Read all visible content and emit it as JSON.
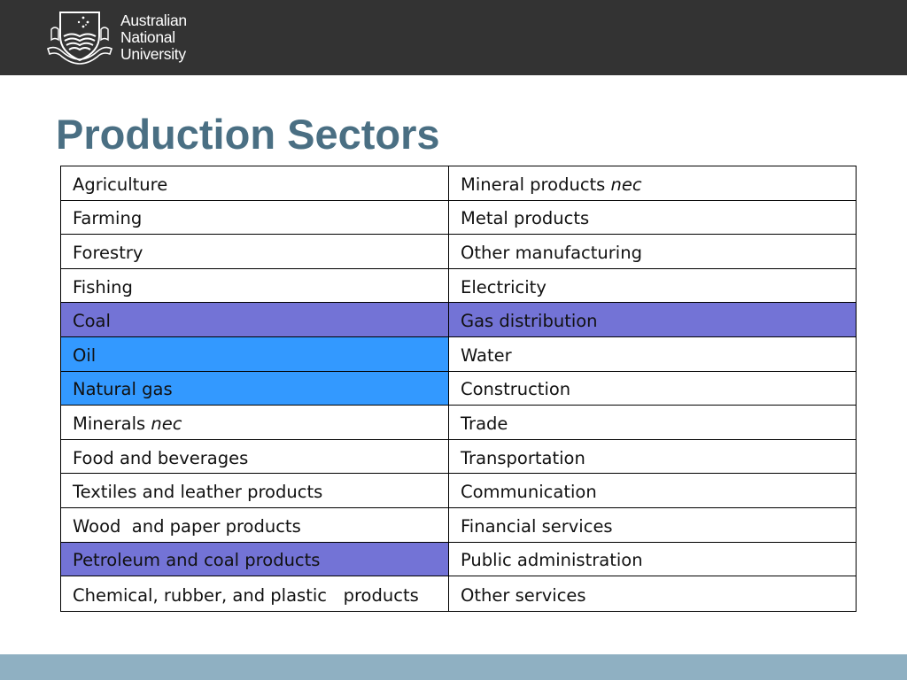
{
  "header": {
    "logo_lines": [
      "Australian",
      "National",
      "University"
    ],
    "crest_icon": "anu-crest-icon",
    "background": "#333333"
  },
  "slide": {
    "title": "Production Sectors",
    "title_color": "#4a6f83"
  },
  "table": {
    "highlight_colors": {
      "purple": "#7373d6",
      "blue": "#3399ff"
    },
    "rows": [
      {
        "left": {
          "text": "Agriculture",
          "suffix": "",
          "highlight": ""
        },
        "right": {
          "text": "Mineral products ",
          "suffix": "nec",
          "highlight": ""
        }
      },
      {
        "left": {
          "text": "Farming",
          "suffix": "",
          "highlight": ""
        },
        "right": {
          "text": "Metal products",
          "suffix": "",
          "highlight": ""
        }
      },
      {
        "left": {
          "text": "Forestry",
          "suffix": "",
          "highlight": ""
        },
        "right": {
          "text": "Other manufacturing",
          "suffix": "",
          "highlight": ""
        }
      },
      {
        "left": {
          "text": "Fishing",
          "suffix": "",
          "highlight": ""
        },
        "right": {
          "text": "Electricity",
          "suffix": "",
          "highlight": ""
        }
      },
      {
        "left": {
          "text": "Coal",
          "suffix": "",
          "highlight": "purple"
        },
        "right": {
          "text": "Gas distribution",
          "suffix": "",
          "highlight": "purple"
        }
      },
      {
        "left": {
          "text": "Oil",
          "suffix": "",
          "highlight": "blue"
        },
        "right": {
          "text": "Water",
          "suffix": "",
          "highlight": ""
        }
      },
      {
        "left": {
          "text": "Natural gas",
          "suffix": "",
          "highlight": "blue"
        },
        "right": {
          "text": "Construction",
          "suffix": "",
          "highlight": ""
        }
      },
      {
        "left": {
          "text": "Minerals ",
          "suffix": "nec",
          "highlight": ""
        },
        "right": {
          "text": "Trade",
          "suffix": "",
          "highlight": ""
        }
      },
      {
        "left": {
          "text": "Food and beverages",
          "suffix": "",
          "highlight": ""
        },
        "right": {
          "text": "Transportation",
          "suffix": "",
          "highlight": ""
        }
      },
      {
        "left": {
          "text": "Textiles and leather products",
          "suffix": "",
          "highlight": ""
        },
        "right": {
          "text": "Communication",
          "suffix": "",
          "highlight": ""
        }
      },
      {
        "left": {
          "text": "Wood  and paper products",
          "suffix": "",
          "highlight": ""
        },
        "right": {
          "text": "Financial services",
          "suffix": "",
          "highlight": ""
        }
      },
      {
        "left": {
          "text": "Petroleum and coal products",
          "suffix": "",
          "highlight": "purple"
        },
        "right": {
          "text": "Public administration",
          "suffix": "",
          "highlight": ""
        }
      },
      {
        "left": {
          "text": "Chemical, rubber, and plastic   products",
          "suffix": "",
          "highlight": ""
        },
        "right": {
          "text": "Other services",
          "suffix": "",
          "highlight": ""
        }
      }
    ]
  },
  "footer": {
    "background": "#8fb0c2"
  }
}
